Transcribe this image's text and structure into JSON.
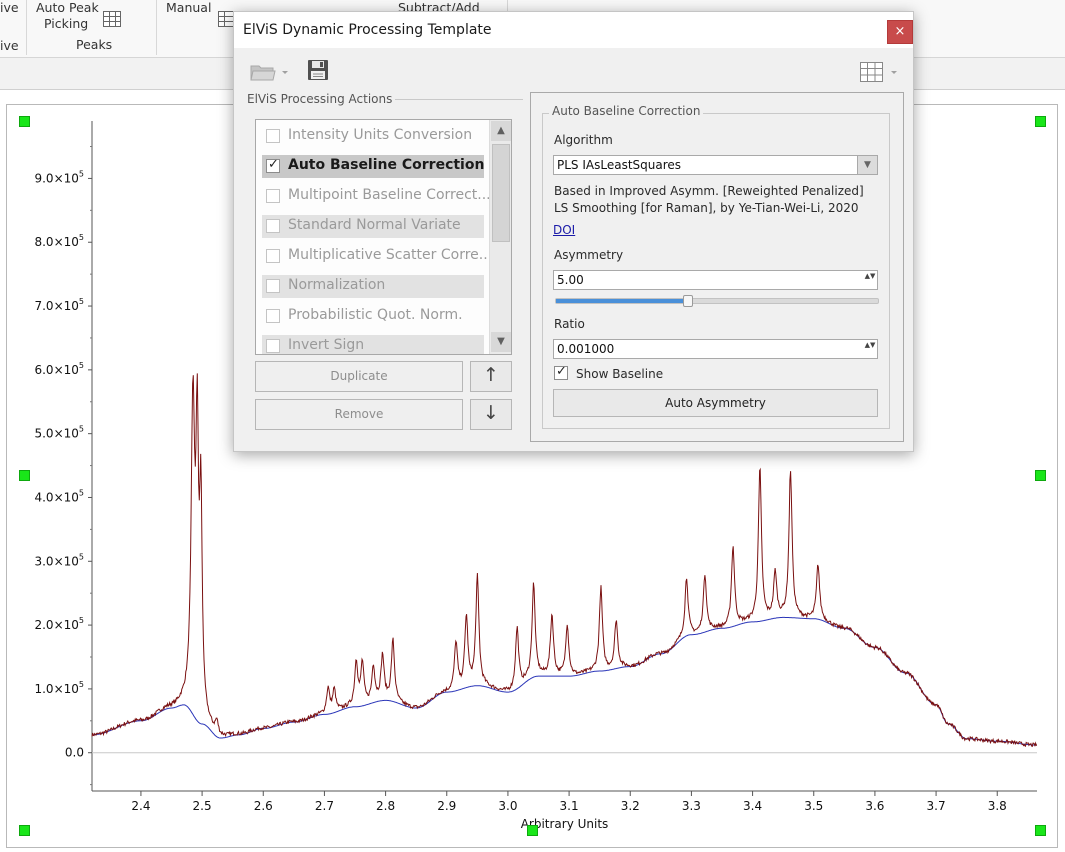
{
  "ribbon": {
    "frag_left_top": "ive",
    "frag_left_bottom": "ive",
    "auto_peak_line1": "Auto Peak",
    "auto_peak_line2": "Picking",
    "peaks_group": "Peaks",
    "manual": "Manual",
    "subtract_add": "Subtract/Add"
  },
  "dialog": {
    "title": "ElViS Dynamic Processing Template",
    "close_glyph": "×",
    "actions_group_label": "ElViS Processing Actions",
    "actions": [
      {
        "label": "Intensity Units Conversion",
        "checked": false
      },
      {
        "label": "Auto Baseline Correction",
        "checked": true
      },
      {
        "label": "Multipoint Baseline Correct...",
        "checked": false
      },
      {
        "label": "Standard Normal Variate",
        "checked": false
      },
      {
        "label": "Multiplicative Scatter Corre...",
        "checked": false
      },
      {
        "label": "Normalization",
        "checked": false
      },
      {
        "label": "Probabilistic Quot. Norm.",
        "checked": false
      },
      {
        "label": "Invert Sign",
        "checked": false
      }
    ],
    "check_glyph": "✓",
    "scroll_up_glyph": "▲",
    "scroll_down_glyph": "▼",
    "duplicate_label": "Duplicate",
    "remove_label": "Remove",
    "move_up_glyph": "↑",
    "move_down_glyph": "↓",
    "props": {
      "group_label": "Auto Baseline Correction",
      "algorithm_label": "Algorithm",
      "algorithm_value": "PLS IAsLeastSquares",
      "dropdown_glyph": "▼",
      "description_line1": "Based in Improved Asymm. [Reweighted Penalized]",
      "description_line2": "LS Smoothing [for Raman], by Ye-Tian-Wei-Li, 2020",
      "doi_label": "DOI",
      "asymmetry_label": "Asymmetry",
      "asymmetry_value": "5.00",
      "asymmetry_slider": 0.41,
      "ratio_label": "Ratio",
      "ratio_value": "0.001000",
      "show_baseline_label": "Show Baseline",
      "show_baseline_checked": true,
      "auto_asymmetry_label": "Auto Asymmetry",
      "spin_glyph": "▲▼"
    }
  },
  "colors": {
    "spectrum": "#7a1010",
    "baseline": "#2a35b8",
    "handle": "#19e619",
    "close_button": "#c84b4b",
    "slider_fill": "#4a90d9"
  },
  "chart_data": {
    "type": "line",
    "xlabel": "Arbitrary Units",
    "ylabel": "",
    "xlim": [
      2.32,
      3.865
    ],
    "ylim": [
      -60000,
      990000
    ],
    "x_ticks": [
      2.4,
      2.5,
      2.6,
      2.7,
      2.8,
      2.9,
      3.0,
      3.1,
      3.2,
      3.3,
      3.4,
      3.5,
      3.6,
      3.7,
      3.8
    ],
    "x_tick_labels": [
      "2.4",
      "2.5",
      "2.6",
      "2.7",
      "2.8",
      "2.9",
      "3.0",
      "3.1",
      "3.2",
      "3.3",
      "3.4",
      "3.5",
      "3.6",
      "3.7",
      "3.8"
    ],
    "y_ticks": [
      0,
      100000,
      200000,
      300000,
      400000,
      500000,
      600000,
      700000,
      800000,
      900000
    ],
    "y_tick_mantissa": [
      "0.0",
      "1.0×10",
      "2.0×10",
      "3.0×10",
      "4.0×10",
      "5.0×10",
      "6.0×10",
      "7.0×10",
      "8.0×10",
      "9.0×10"
    ],
    "y_tick_exponent": [
      "",
      "5",
      "5",
      "5",
      "5",
      "5",
      "5",
      "5",
      "5",
      "5"
    ],
    "grid": false,
    "legend": "none",
    "baseline": {
      "x": [
        2.32,
        2.4,
        2.45,
        2.47,
        2.5,
        2.53,
        2.56,
        2.6,
        2.65,
        2.7,
        2.75,
        2.8,
        2.85,
        2.9,
        2.95,
        3.0,
        3.05,
        3.1,
        3.15,
        3.2,
        3.25,
        3.3,
        3.35,
        3.4,
        3.45,
        3.5,
        3.55,
        3.6,
        3.65,
        3.7,
        3.72,
        3.75,
        3.8,
        3.865
      ],
      "y": [
        28000,
        50000,
        70000,
        75000,
        45000,
        23000,
        28000,
        38000,
        48000,
        60000,
        72000,
        82000,
        70000,
        95000,
        105000,
        95000,
        120000,
        120000,
        128000,
        135000,
        155000,
        185000,
        195000,
        205000,
        212000,
        210000,
        195000,
        165000,
        125000,
        75000,
        45000,
        22000,
        18000,
        12000
      ]
    },
    "peaks": [
      {
        "x": 2.485,
        "height": 480000,
        "width": 0.0035
      },
      {
        "x": 2.492,
        "height": 400000,
        "width": 0.0025
      },
      {
        "x": 2.498,
        "height": 330000,
        "width": 0.0025
      },
      {
        "x": 2.524,
        "height": 20000,
        "width": 0.003
      },
      {
        "x": 2.706,
        "height": 40000,
        "width": 0.003
      },
      {
        "x": 2.716,
        "height": 35000,
        "width": 0.003
      },
      {
        "x": 2.752,
        "height": 70000,
        "width": 0.003
      },
      {
        "x": 2.762,
        "height": 65000,
        "width": 0.003
      },
      {
        "x": 2.78,
        "height": 55000,
        "width": 0.003
      },
      {
        "x": 2.795,
        "height": 70000,
        "width": 0.003
      },
      {
        "x": 2.812,
        "height": 95000,
        "width": 0.003
      },
      {
        "x": 2.915,
        "height": 75000,
        "width": 0.003
      },
      {
        "x": 2.932,
        "height": 110000,
        "width": 0.003
      },
      {
        "x": 2.95,
        "height": 170000,
        "width": 0.003
      },
      {
        "x": 3.015,
        "height": 95000,
        "width": 0.003
      },
      {
        "x": 3.042,
        "height": 145000,
        "width": 0.003
      },
      {
        "x": 3.072,
        "height": 95000,
        "width": 0.003
      },
      {
        "x": 3.097,
        "height": 80000,
        "width": 0.003
      },
      {
        "x": 3.152,
        "height": 130000,
        "width": 0.003
      },
      {
        "x": 3.177,
        "height": 75000,
        "width": 0.003
      },
      {
        "x": 3.292,
        "height": 90000,
        "width": 0.003
      },
      {
        "x": 3.322,
        "height": 90000,
        "width": 0.003
      },
      {
        "x": 3.368,
        "height": 125000,
        "width": 0.003
      },
      {
        "x": 3.412,
        "height": 240000,
        "width": 0.003
      },
      {
        "x": 3.437,
        "height": 70000,
        "width": 0.003
      },
      {
        "x": 3.462,
        "height": 230000,
        "width": 0.003
      },
      {
        "x": 3.507,
        "height": 85000,
        "width": 0.003
      }
    ]
  }
}
